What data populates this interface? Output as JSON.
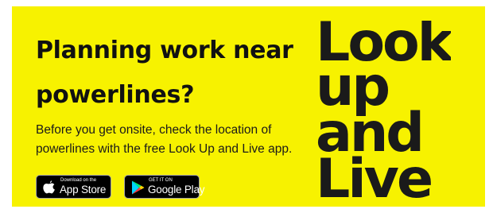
{
  "banner": {
    "background_color": "#f7f200",
    "text_color": "#111111",
    "heading_line1": "Planning work near",
    "heading_line2": "powerlines?",
    "description_line1": "Before you get onsite, check the location of",
    "description_line2": "powerlines with the free Look Up and Live app."
  },
  "stores": {
    "app_store": {
      "icon": "apple-icon",
      "small_label": "Download on the",
      "big_label": "App Store"
    },
    "google_play": {
      "icon": "google-play-icon",
      "small_label": "GET IT ON",
      "big_label": "Google Play"
    }
  },
  "logo": {
    "line1": "Look",
    "line2": "up",
    "line3": "and",
    "line4": "Live"
  }
}
